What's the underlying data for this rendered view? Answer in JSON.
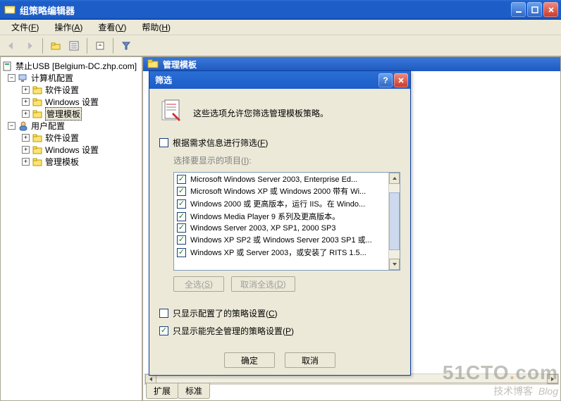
{
  "window": {
    "title": "组策略编辑器",
    "menus": [
      {
        "label": "文件(",
        "hot": "F",
        "tail": ")"
      },
      {
        "label": "操作(",
        "hot": "A",
        "tail": ")"
      },
      {
        "label": "查看(",
        "hot": "V",
        "tail": ")"
      },
      {
        "label": "帮助(",
        "hot": "H",
        "tail": ")"
      }
    ]
  },
  "tree": {
    "root": "禁止USB [Belgium-DC.zhp.com]",
    "comp": "计算机配置",
    "comp_children": [
      "软件设置",
      "Windows 设置",
      "管理模板"
    ],
    "user": "用户配置",
    "user_children": [
      "软件设置",
      "Windows 设置",
      "管理模板"
    ]
  },
  "content": {
    "header": "管理模板",
    "tabs": [
      "扩展",
      "标准"
    ]
  },
  "dialog": {
    "title": "筛选",
    "desc": "这些选项允许您筛选管理模板策略。",
    "filter_cb": "根据需求信息进行筛选(",
    "filter_hot": "F",
    "filter_tail": ")",
    "group_label": "选择要显示的项目(",
    "group_hot": "I",
    "group_tail": "):",
    "items": [
      "Microsoft Windows Server 2003, Enterprise Ed...",
      "Microsoft Windows XP 或 Windows 2000 带有 Wi...",
      "Windows 2000 或 更高版本，运行 IIS。在 Windo...",
      "Windows Media Player 9 系列及更高版本。",
      "Windows Server 2003, XP SP1, 2000 SP3",
      "Windows XP SP2 或 Windows Server 2003 SP1 或...",
      "Windows XP 或 Server 2003，或安装了 RITS 1.5..."
    ],
    "select_all": "全选(",
    "select_all_hot": "S",
    "select_all_tail": ")",
    "deselect_all": "取消全选(",
    "deselect_all_hot": "D",
    "deselect_all_tail": ")",
    "only_configured": "只显示配置了的策略设置(",
    "only_configured_hot": "C",
    "only_configured_tail": ")",
    "only_managed": "只显示能完全管理的策略设置(",
    "only_managed_hot": "P",
    "only_managed_tail": ")",
    "ok": "确定",
    "cancel": "取消"
  },
  "watermark": {
    "brand": "51CTO",
    "dot": ".",
    "com": "com",
    "sub": "技术博客",
    "tag": "Blog"
  }
}
